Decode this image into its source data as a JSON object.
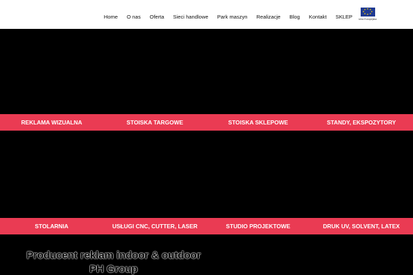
{
  "nav": {
    "items": [
      {
        "label": "Home"
      },
      {
        "label": "O nas"
      },
      {
        "label": "Oferta"
      },
      {
        "label": "Sieci handlowe"
      },
      {
        "label": "Park maszyn"
      },
      {
        "label": "Realizacje"
      },
      {
        "label": "Blog"
      },
      {
        "label": "Kontakt"
      },
      {
        "label": "SKLEP"
      }
    ]
  },
  "eu": {
    "caption": "Unia Europejska",
    "flag_color": "#1f3a93",
    "star_color": "#ffd400"
  },
  "tiles_row1": [
    {
      "label": "REKLAMA WIZUALNA"
    },
    {
      "label": "STOISKA TARGOWE"
    },
    {
      "label": "STOISKA SKLEPOWE"
    },
    {
      "label": "STANDY, EKSPOZYTORY"
    }
  ],
  "tiles_row2": [
    {
      "label": "STOLARNIA"
    },
    {
      "label": "USŁUGI CNC, CUTTER, LASER"
    },
    {
      "label": "STUDIO PROJEKTOWE"
    },
    {
      "label": "DRUK UV, SOLVENT, LATEX"
    }
  ],
  "footer": {
    "line1": "Producent reklam indoor & outdoor",
    "line2": "PH Group"
  },
  "colors": {
    "accent": "#ea3b53",
    "background": "#000000",
    "header": "#ffffff"
  }
}
